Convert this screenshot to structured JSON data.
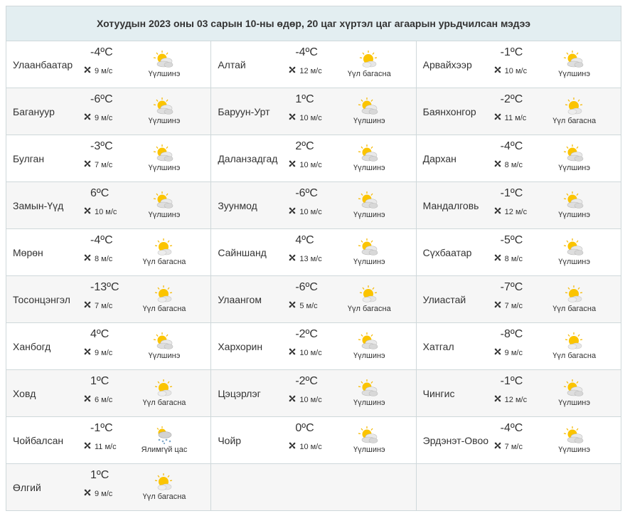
{
  "title": "Хотуудын 2023 оны 03 сарын 10-ны өдөр, 20 цаг хүртэл цаг агаарын урьдчилсан мэдээ",
  "rows": [
    [
      {
        "city": "Улаанбаатар",
        "temp": "-4ºC",
        "wind": "9 м/с",
        "cond": "Үүлшинэ",
        "icon": "partly-cloudy-icon"
      },
      {
        "city": "Алтай",
        "temp": "-4ºC",
        "wind": "12 м/с",
        "cond": "Үүл багасна",
        "icon": "sun-cloud-icon"
      },
      {
        "city": "Арвайхээр",
        "temp": "-1ºC",
        "wind": "10 м/с",
        "cond": "Үүлшинэ",
        "icon": "partly-cloudy-icon"
      }
    ],
    [
      {
        "city": "Багануур",
        "temp": "-6ºC",
        "wind": "9 м/с",
        "cond": "Үүлшинэ",
        "icon": "partly-cloudy-icon"
      },
      {
        "city": "Баруун-Урт",
        "temp": "1ºC",
        "wind": "10 м/с",
        "cond": "Үүлшинэ",
        "icon": "partly-cloudy-icon"
      },
      {
        "city": "Баянхонгор",
        "temp": "-2ºC",
        "wind": "11 м/с",
        "cond": "Үүл багасна",
        "icon": "sun-cloud-icon"
      }
    ],
    [
      {
        "city": "Булган",
        "temp": "-3ºC",
        "wind": "7 м/с",
        "cond": "Үүлшинэ",
        "icon": "partly-cloudy-icon"
      },
      {
        "city": "Даланзадгад",
        "temp": "2ºC",
        "wind": "10 м/с",
        "cond": "Үүлшинэ",
        "icon": "partly-cloudy-icon"
      },
      {
        "city": "Дархан",
        "temp": "-4ºC",
        "wind": "8 м/с",
        "cond": "Үүлшинэ",
        "icon": "partly-cloudy-icon"
      }
    ],
    [
      {
        "city": "Замын-Үүд",
        "temp": "6ºC",
        "wind": "10 м/с",
        "cond": "Үүлшинэ",
        "icon": "partly-cloudy-icon"
      },
      {
        "city": "Зуунмод",
        "temp": "-6ºC",
        "wind": "10 м/с",
        "cond": "Үүлшинэ",
        "icon": "partly-cloudy-icon"
      },
      {
        "city": "Мандалговь",
        "temp": "-1ºC",
        "wind": "12 м/с",
        "cond": "Үүлшинэ",
        "icon": "partly-cloudy-icon"
      }
    ],
    [
      {
        "city": "Мөрөн",
        "temp": "-4ºC",
        "wind": "8 м/с",
        "cond": "Үүл багасна",
        "icon": "sun-cloud-icon"
      },
      {
        "city": "Сайншанд",
        "temp": "4ºC",
        "wind": "13 м/с",
        "cond": "Үүлшинэ",
        "icon": "partly-cloudy-icon"
      },
      {
        "city": "Сүхбаатар",
        "temp": "-5ºC",
        "wind": "8 м/с",
        "cond": "Үүлшинэ",
        "icon": "partly-cloudy-icon"
      }
    ],
    [
      {
        "city": "Тосонцэнгэл",
        "temp": "-13ºC",
        "wind": "7 м/с",
        "cond": "Үүл багасна",
        "icon": "sun-cloud-icon"
      },
      {
        "city": "Улаангом",
        "temp": "-6ºC",
        "wind": "5 м/с",
        "cond": "Үүл багасна",
        "icon": "sun-cloud-icon"
      },
      {
        "city": "Улиастай",
        "temp": "-7ºC",
        "wind": "7 м/с",
        "cond": "Үүл багасна",
        "icon": "sun-cloud-icon"
      }
    ],
    [
      {
        "city": "Ханбогд",
        "temp": "4ºC",
        "wind": "9 м/с",
        "cond": "Үүлшинэ",
        "icon": "partly-cloudy-icon"
      },
      {
        "city": "Хархорин",
        "temp": "-2ºC",
        "wind": "10 м/с",
        "cond": "Үүлшинэ",
        "icon": "partly-cloudy-icon"
      },
      {
        "city": "Хатгал",
        "temp": "-8ºC",
        "wind": "9 м/с",
        "cond": "Үүл багасна",
        "icon": "sun-cloud-icon"
      }
    ],
    [
      {
        "city": "Ховд",
        "temp": "1ºC",
        "wind": "6 м/с",
        "cond": "Үүл багасна",
        "icon": "sun-cloud-icon"
      },
      {
        "city": "Цэцэрлэг",
        "temp": "-2ºC",
        "wind": "10 м/с",
        "cond": "Үүлшинэ",
        "icon": "partly-cloudy-icon"
      },
      {
        "city": "Чингис",
        "temp": "-1ºC",
        "wind": "12 м/с",
        "cond": "Үүлшинэ",
        "icon": "partly-cloudy-icon"
      }
    ],
    [
      {
        "city": "Чойбалсан",
        "temp": "-1ºC",
        "wind": "11 м/с",
        "cond": "Ялимгүй цас",
        "icon": "light-snow-icon"
      },
      {
        "city": "Чойр",
        "temp": "0ºC",
        "wind": "10 м/с",
        "cond": "Үүлшинэ",
        "icon": "partly-cloudy-icon"
      },
      {
        "city": "Эрдэнэт-Овоо",
        "temp": "-4ºC",
        "wind": "7 м/с",
        "cond": "Үүлшинэ",
        "icon": "partly-cloudy-icon"
      }
    ],
    [
      {
        "city": "Өлгий",
        "temp": "1ºC",
        "wind": "9 м/с",
        "cond": "Үүл багасна",
        "icon": "sun-cloud-icon"
      },
      null,
      null
    ]
  ],
  "colors": {
    "header_bg": "#e3eef1",
    "border": "#cfd8da",
    "row_alt": "#f6f6f6",
    "sun": "#f5b800",
    "cloud": "#dcdcdc"
  }
}
